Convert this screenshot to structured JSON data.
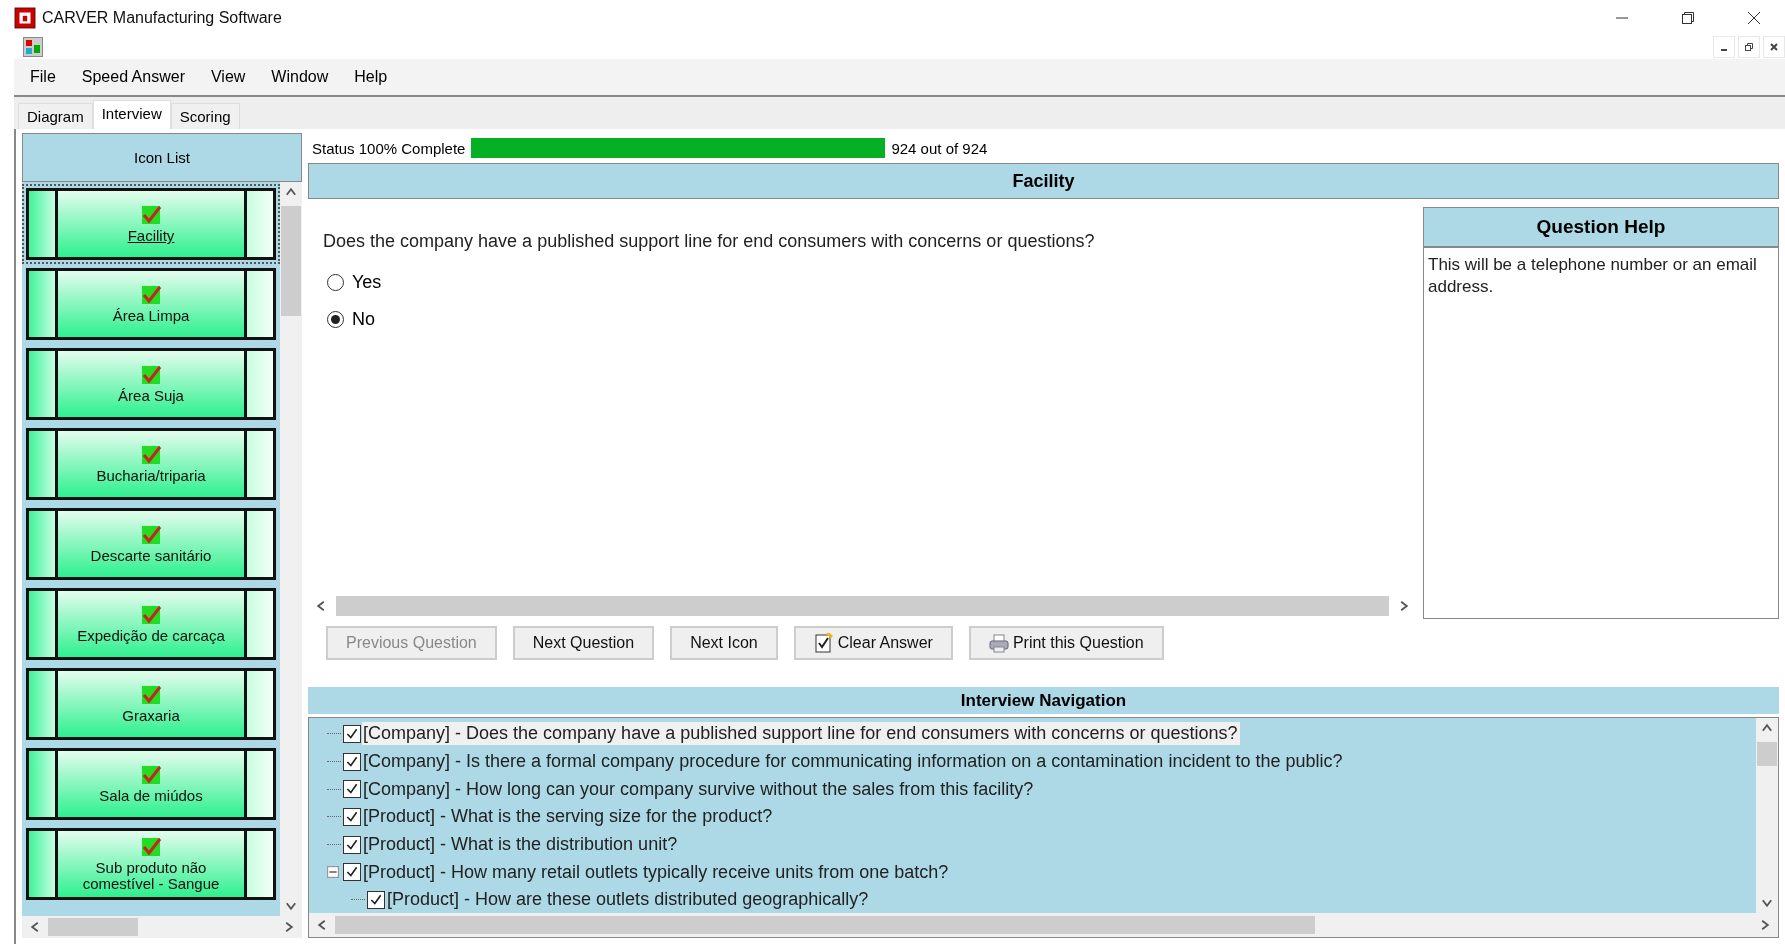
{
  "window": {
    "title": "CARVER Manufacturing Software"
  },
  "menu": [
    "File",
    "Speed Answer",
    "View",
    "Window",
    "Help"
  ],
  "tabs": [
    {
      "label": "Diagram",
      "selected": false
    },
    {
      "label": "Interview",
      "selected": true
    },
    {
      "label": "Scoring",
      "selected": false
    }
  ],
  "icon_list": {
    "title": "Icon List",
    "items": [
      {
        "label": "Facility",
        "selected": true,
        "answered": true
      },
      {
        "label": "Área Limpa",
        "selected": false,
        "answered": true
      },
      {
        "label": "Área Suja",
        "selected": false,
        "answered": true
      },
      {
        "label": "Bucharia/triparia",
        "selected": false,
        "answered": true
      },
      {
        "label": "Descarte sanitário",
        "selected": false,
        "answered": true
      },
      {
        "label": "Expedição de carcaça",
        "selected": false,
        "answered": true
      },
      {
        "label": "Graxaria",
        "selected": false,
        "answered": true
      },
      {
        "label": "Sala de miúdos",
        "selected": false,
        "answered": true
      },
      {
        "label": "Sub produto não comestível - Sangue",
        "selected": false,
        "answered": true
      }
    ]
  },
  "status": {
    "label": "Status 100% Complete",
    "level": 1.0,
    "count": "924 out of 924"
  },
  "section_title": "Facility",
  "question": {
    "text": "Does the company have a published support line for end consumers with concerns or questions?",
    "options": [
      {
        "label": "Yes",
        "selected": false
      },
      {
        "label": "No",
        "selected": true
      }
    ]
  },
  "help": {
    "title": "Question Help",
    "text": "This will be a telephone number or an email address."
  },
  "buttons": [
    {
      "label": "Previous Question",
      "kind": "plain",
      "disabled": true
    },
    {
      "label": "Next Question",
      "kind": "plain",
      "disabled": false
    },
    {
      "label": "Next Icon",
      "kind": "plain",
      "disabled": false
    },
    {
      "label": "Clear Answer",
      "kind": "clear",
      "disabled": false
    },
    {
      "label": "Print this Question",
      "kind": "print",
      "disabled": false
    }
  ],
  "navigation": {
    "title": "Interview Navigation",
    "items": [
      {
        "text": "[Company] - Does the company have a published support line for end consumers with concerns or questions?",
        "checked": true,
        "selected": true
      },
      {
        "text": "[Company] - Is there a formal company procedure for communicating information on a contamination incident to the public?",
        "checked": true,
        "selected": false
      },
      {
        "text": "[Company] - How long can your company survive without the sales from this facility?",
        "checked": true,
        "selected": false
      },
      {
        "text": "[Product] - What is the serving size for the product?",
        "checked": true,
        "selected": false
      },
      {
        "text": "[Product] - What is the distribution unit?",
        "checked": true,
        "selected": false
      },
      {
        "text": "[Product] - How many retail outlets typically receive units from one batch?",
        "checked": true,
        "selected": false,
        "expanded": true,
        "children": [
          {
            "text": "[Product] - How are these outlets distributed geographically?",
            "checked": true,
            "selected": false
          }
        ]
      }
    ]
  }
}
